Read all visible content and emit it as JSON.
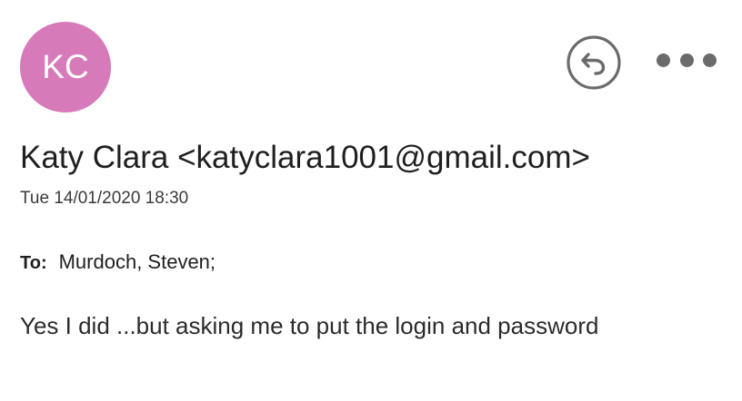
{
  "message": {
    "avatar": {
      "initials": "KC",
      "color": "#d77ab9"
    },
    "sender": "Katy Clara <katyclara1001@gmail.com>",
    "date": "Tue 14/01/2020 18:30",
    "to_label": "To:",
    "to_value": "Murdoch, Steven;",
    "body": "Yes I did ...but asking me to put the login and password"
  },
  "actions": {
    "reply_icon": "reply-arrow-icon",
    "more_icon": "more-options-icon"
  }
}
